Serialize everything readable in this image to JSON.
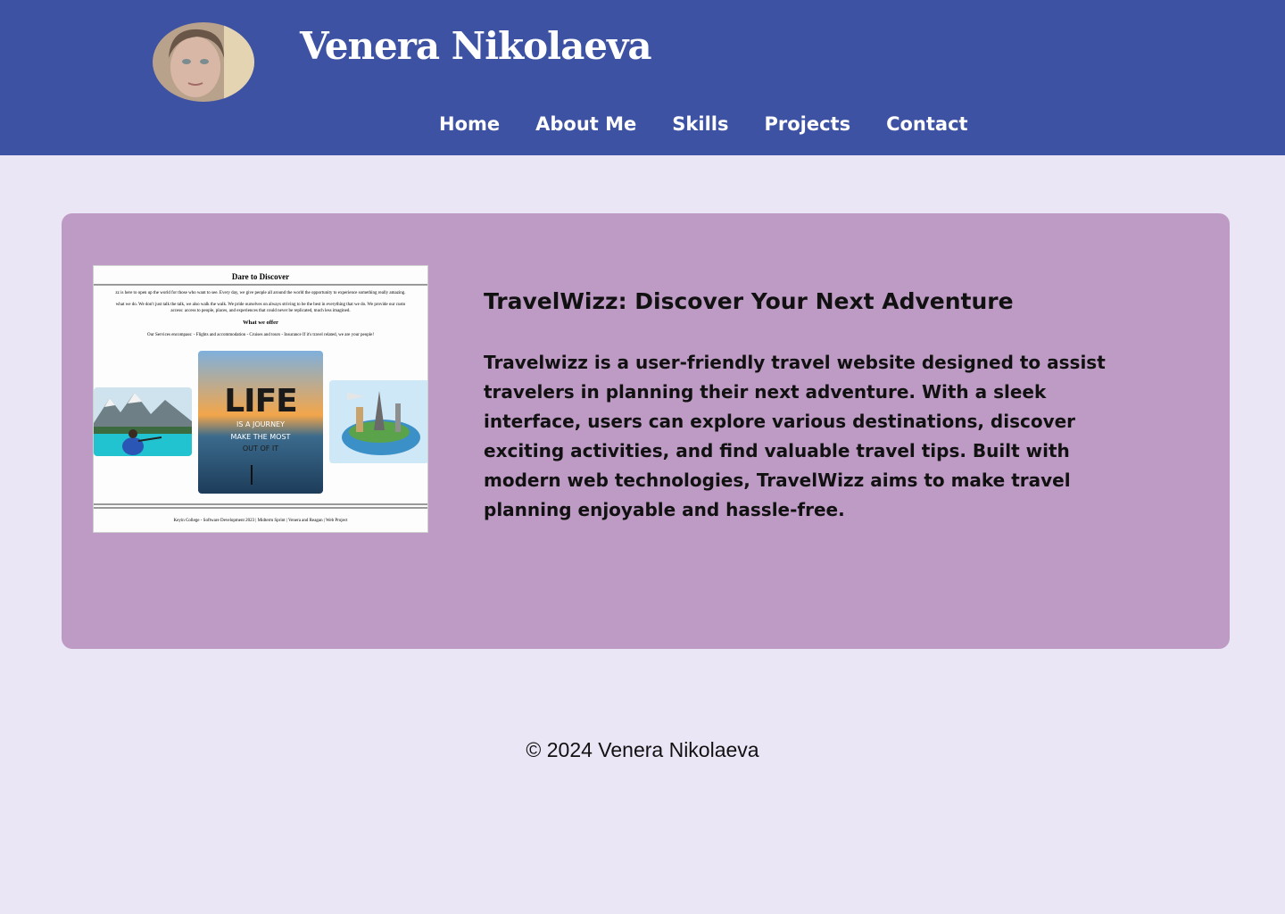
{
  "header": {
    "site_title": "Venera Nikolaeva",
    "nav": [
      "Home",
      "About Me",
      "Skills",
      "Projects",
      "Contact"
    ]
  },
  "project": {
    "title": "TravelWizz: Discover Your Next Adventure",
    "description": "Travelwizz is a user-friendly travel website designed to assist travelers in planning their next adventure. With a sleek interface, users can explore various destinations, discover exciting activities, and find valuable travel tips. Built with modern web technologies, TravelWizz aims to make travel planning enjoyable and hassle-free.",
    "screenshot": {
      "heading": "Dare to Discover",
      "intro_1": "zz is here to open up the world for those who want to see. Every day, we give people all around the world the opportunity to experience something really amazing.",
      "intro_2": "what we do. We don't just talk the talk, we also walk the walk. We pride ourselves on always striving to be the best in everything that we do. We provide our custo",
      "intro_3": "access: access to people, places, and experiences that could never be replicated, much less imagined.",
      "offer_heading": "What we offer",
      "offer_text": "Our Services encompass: - Flights and accommodation - Cruises and tours - Insurance If it's travel related, we are your people!",
      "poster_big": "LIFE",
      "poster_line_1": "IS A JOURNEY",
      "poster_line_2": "MAKE THE MOST",
      "poster_line_3": "OUT OF IT",
      "footer": "Keyin College - Software Development 2023 | Midterm Sprint | Venera and Reagan | Web Project"
    }
  },
  "footer": {
    "copyright": "© 2024 Venera Nikolaeva"
  },
  "colors": {
    "header_bg": "#3d52a2",
    "page_bg": "#ebe6f5",
    "card_bg": "#be9bc5"
  }
}
